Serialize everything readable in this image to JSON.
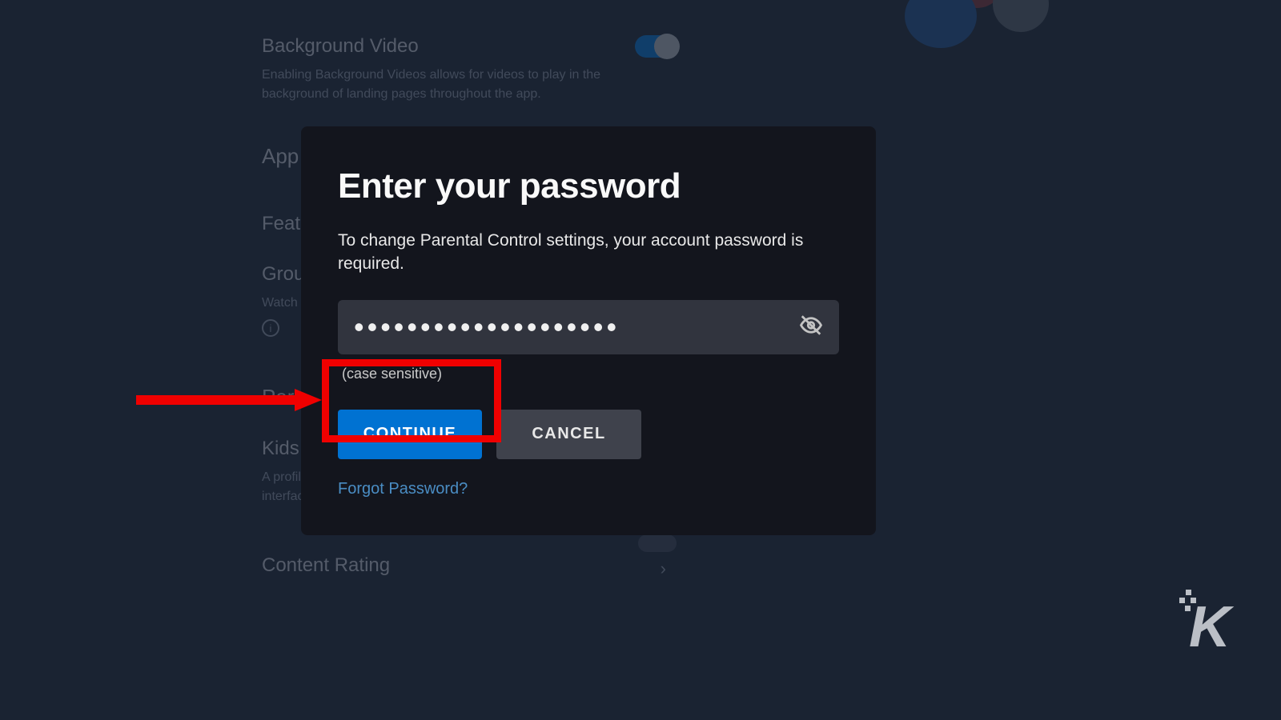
{
  "background": {
    "background_video": {
      "title": "Background Video",
      "description": "Enabling Background Videos allows for videos to play in the background of landing pages throughout the app."
    },
    "app_section": "App",
    "featured": "Feat",
    "group": {
      "title": "Group",
      "watch": "Watch"
    },
    "parental_section": "Pare",
    "kids": {
      "title": "Kids P",
      "desc1": "A profil",
      "desc2": "interfac"
    },
    "content_rating": "Content Rating"
  },
  "modal": {
    "title": "Enter your password",
    "description": "To change Parental Control settings, your account password is required.",
    "password_value": "••••••••••••••••••••",
    "hint": "(case sensitive)",
    "continue_label": "CONTINUE",
    "cancel_label": "CANCEL",
    "forgot_label": "Forgot Password?"
  },
  "watermark": {
    "letter": "K"
  }
}
